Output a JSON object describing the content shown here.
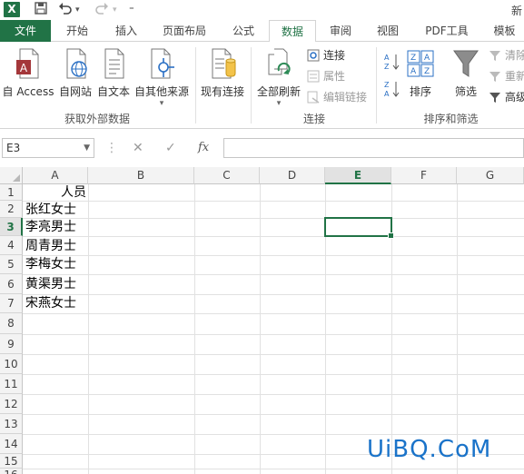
{
  "title": {
    "app_logo": "X",
    "doc_title_partial": "新"
  },
  "tabs": [
    {
      "label": "文件"
    },
    {
      "label": "开始"
    },
    {
      "label": "插入"
    },
    {
      "label": "页面布局"
    },
    {
      "label": "公式"
    },
    {
      "label": "数据"
    },
    {
      "label": "审阅"
    },
    {
      "label": "视图"
    },
    {
      "label": "PDF工具"
    },
    {
      "label": "模板"
    }
  ],
  "ribbon": {
    "get_external": {
      "buttons": [
        {
          "label": "自 Access",
          "icon": "access-icon"
        },
        {
          "label": "自网站",
          "icon": "web-icon"
        },
        {
          "label": "自文本",
          "icon": "text-file-icon"
        },
        {
          "label": "自其他来源",
          "icon": "other-sources-icon"
        }
      ],
      "group_label": "获取外部数据"
    },
    "existing_connections": {
      "label": "现有连接"
    },
    "connections": {
      "refresh_all": "全部刷新",
      "connect": "连接",
      "properties": "属性",
      "edit_links": "编辑链接",
      "group_label": "连接"
    },
    "sort_filter": {
      "sort": "排序",
      "filter": "筛选",
      "clear": "清除",
      "reapply": "重新",
      "advanced": "高级",
      "group_label": "排序和筛选"
    }
  },
  "formula_bar": {
    "name_box": "E3",
    "fx": "fx",
    "cancel": "✕",
    "enter": "✓"
  },
  "grid": {
    "columns": [
      "A",
      "B",
      "C",
      "D",
      "E",
      "F",
      "G"
    ],
    "rows": [
      "1",
      "2",
      "3",
      "4",
      "5",
      "6",
      "7",
      "8",
      "9",
      "10",
      "11",
      "12",
      "13",
      "14",
      "15",
      "16"
    ],
    "selected_cell": "E3",
    "cells": {
      "A1": "人员",
      "A2": "张红女士",
      "A3": "李亮男士",
      "A4": "周青男士",
      "A5": "李梅女士",
      "A6": "黄渠男士",
      "A7": "宋燕女士"
    }
  },
  "watermark": "UiBQ.CoM"
}
